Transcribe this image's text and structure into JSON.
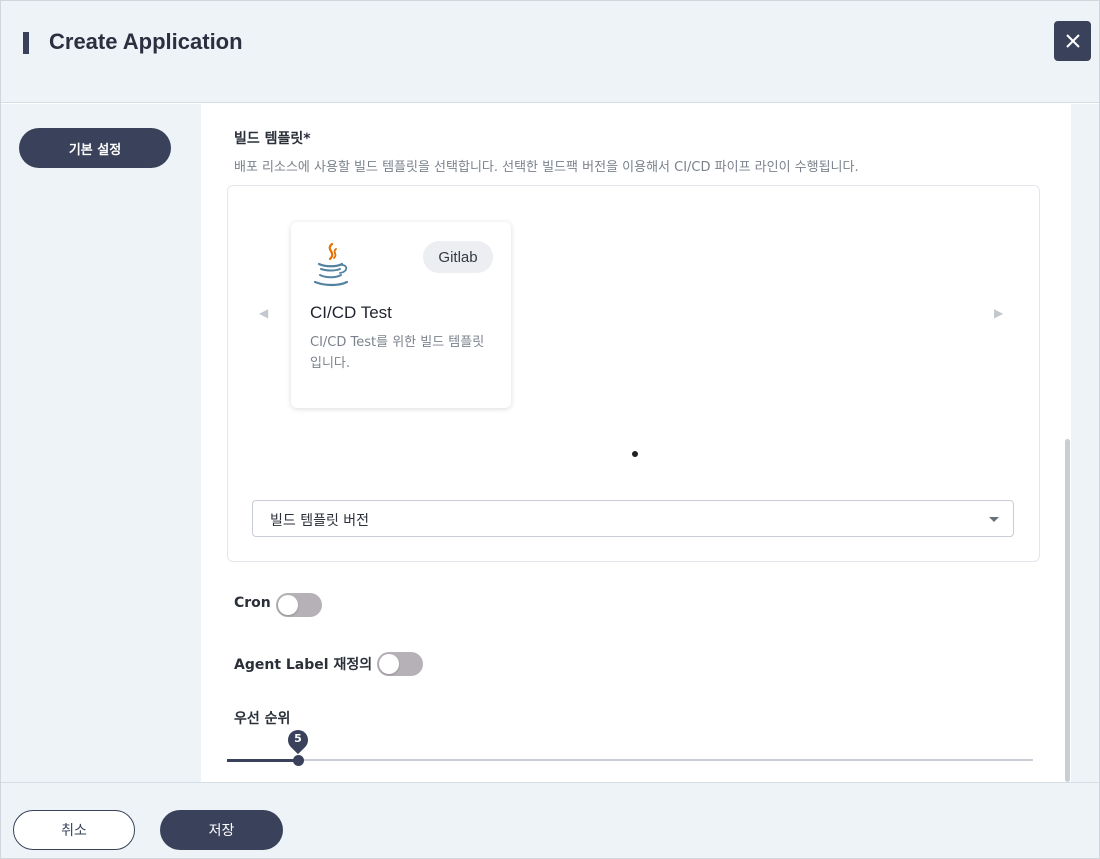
{
  "dialog": {
    "title": "Create Application",
    "close_icon": "close-icon"
  },
  "sidebar": {
    "items": [
      {
        "label": "기본 설정",
        "active": true
      }
    ]
  },
  "build_template": {
    "label": "빌드 템플릿*",
    "description": "배포 리소스에 사용할 빌드 템플릿을 선택합니다. 선택한 빌드팩 버전을 이용해서 CI/CD 파이프 라인이 수행됩니다.",
    "cards": [
      {
        "icon": "java-icon",
        "badge": "Gitlab",
        "title": "CI/CD Test",
        "description": "CI/CD Test를 위한 빌드 템플릿 입니다."
      }
    ],
    "version_select": {
      "value": "빌드 템플릿 버전"
    }
  },
  "options": {
    "cron": {
      "label": "Cron",
      "enabled": false
    },
    "agent_label": {
      "label": "Agent Label 재정의",
      "enabled": false
    },
    "priority": {
      "label": "우선 순위",
      "value": "5",
      "level_fraction": 0.088
    }
  },
  "footer": {
    "cancel_label": "취소",
    "save_label": "저장"
  },
  "colors": {
    "primary": "#39425a",
    "panel_bg": "#eef3f8",
    "toggle_off": "#b5b1b6"
  }
}
